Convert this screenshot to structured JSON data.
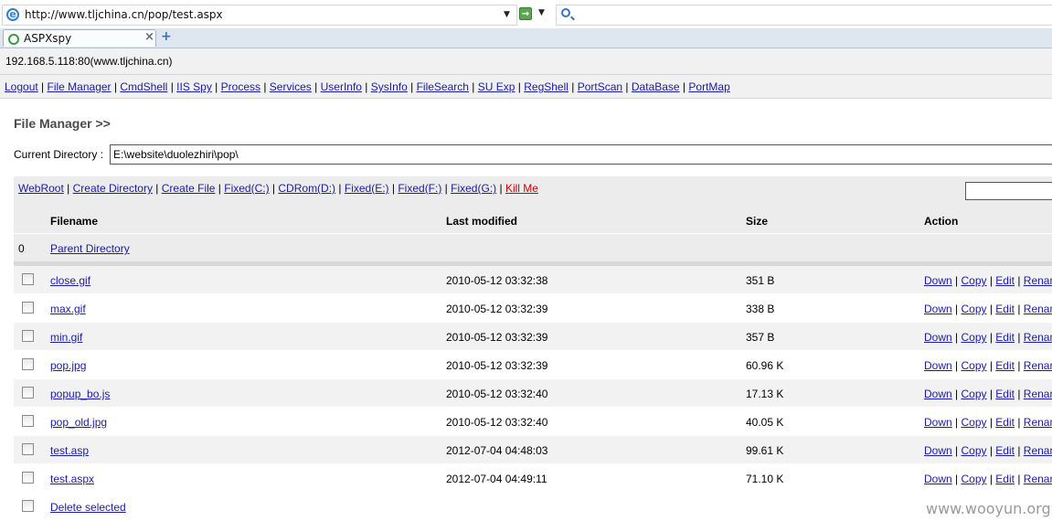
{
  "browser": {
    "url": "http://www.tljchina.cn/pop/test.aspx",
    "tab_title": "ASPXspy",
    "tab_close": "×",
    "new_tab": "+",
    "url_dropdown": "▼",
    "go_dropdown": "▼",
    "go_glyph": "→",
    "ie_glyph": "e"
  },
  "page": {
    "host": "192.168.5.118:80(www.tljchina.cn)",
    "nav": [
      "Logout",
      "File Manager",
      "CmdShell",
      "IIS Spy",
      "Process",
      "Services",
      "UserInfo",
      "SysInfo",
      "FileSearch",
      "SU Exp",
      "RegShell",
      "PortScan",
      "DataBase",
      "PortMap"
    ],
    "title": "File Manager >>",
    "current_dir_label": "Current Directory :",
    "current_dir_value": "E:\\website\\duolezhiri\\pop\\",
    "drives": [
      "WebRoot",
      "Create Directory",
      "Create File",
      "Fixed(C:)",
      "CDRom(D:)",
      "Fixed(E:)",
      "Fixed(F:)",
      "Fixed(G:)"
    ],
    "kill_me": "Kill Me",
    "table": {
      "headers": {
        "filename": "Filename",
        "modified": "Last modified",
        "size": "Size",
        "action": "Action"
      },
      "parent": {
        "index": "0",
        "label": "Parent Directory"
      },
      "files": [
        {
          "name": "close.gif",
          "modified": "2010-05-12 03:32:38",
          "size": "351 B"
        },
        {
          "name": "max.gif",
          "modified": "2010-05-12 03:32:39",
          "size": "338 B"
        },
        {
          "name": "min.gif",
          "modified": "2010-05-12 03:32:39",
          "size": "357 B"
        },
        {
          "name": "pop.jpg",
          "modified": "2010-05-12 03:32:39",
          "size": "60.96 K"
        },
        {
          "name": "popup_bo.js",
          "modified": "2010-05-12 03:32:40",
          "size": "17.13 K"
        },
        {
          "name": "pop_old.jpg",
          "modified": "2010-05-12 03:32:40",
          "size": "40.05 K"
        },
        {
          "name": "test.asp",
          "modified": "2012-07-04 04:48:03",
          "size": "99.61 K"
        },
        {
          "name": "test.aspx",
          "modified": "2012-07-04 04:49:11",
          "size": "71.10 K"
        }
      ],
      "actions": [
        "Down",
        "Copy",
        "Edit",
        "Renam"
      ],
      "delete_selected": "Delete selected"
    }
  },
  "watermark": "www.wooyun.org",
  "colors": {
    "link": "#1a1ab0",
    "kill": "#d40000"
  }
}
